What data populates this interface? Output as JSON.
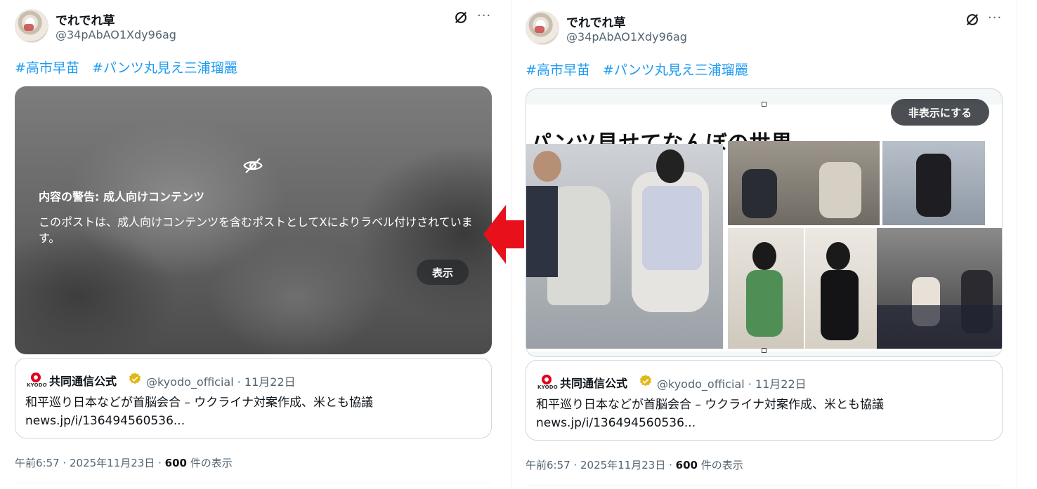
{
  "left_post": {
    "display_name": "でれでれ草",
    "handle": "@34pAbAO1Xdy96ag",
    "more_label": "···",
    "hashtags": [
      "#高市早苗",
      "#パンツ丸見え三浦瑠麗"
    ],
    "media_warning": {
      "title": "内容の警告: 成人向けコンテンツ",
      "body": "このポストは、成人向けコンテンツを含むポストとしてXによりラベル付けされています。",
      "show_label": "表示"
    },
    "quote": {
      "logo_word": "KYODO",
      "name": "共同通信公式",
      "meta": "@kyodo_official · 11月22日",
      "text_line1": "和平巡り日本などが首脳会合 – ウクライナ対案作成、米とも協議",
      "text_line2": "news.jp/i/136494560536..."
    },
    "timestamp_prefix": "午前6:57 · 2025年11月23日 · ",
    "views_count": "600",
    "views_suffix": " 件の表示"
  },
  "right_post": {
    "display_name": "でれでれ草",
    "handle": "@34pAbAO1Xdy96ag",
    "more_label": "···",
    "hashtags": [
      "#高市早苗",
      "#パンツ丸見え三浦瑠麗"
    ],
    "image": {
      "caption": "パンツ見せてなんぼの世界",
      "hide_label": "非表示にする"
    },
    "quote": {
      "logo_word": "KYODO",
      "name": "共同通信公式",
      "meta": "@kyodo_official · 11月22日",
      "text_line1": "和平巡り日本などが首脳会合 – ウクライナ対案作成、米とも協議",
      "text_line2": "news.jp/i/136494560536..."
    },
    "timestamp_prefix": "午前6:57 · 2025年11月23日 · ",
    "views_count": "600",
    "views_suffix": " 件の表示"
  },
  "colors": {
    "link": "#1d9bf0",
    "secondary_text": "#536471",
    "annotation_arrow": "#e8101a",
    "verified_badge": "#e2b719"
  },
  "icons": [
    "grok-icon",
    "more-icon",
    "eye-off-icon",
    "verified-icon",
    "arrow-left-icon"
  ]
}
